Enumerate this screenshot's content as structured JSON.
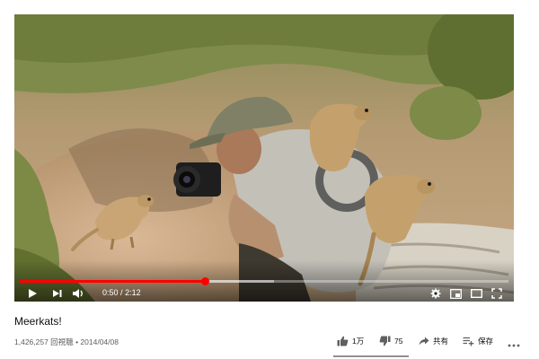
{
  "video": {
    "title": "Meerkats!",
    "views": "1,426,257 回視聴",
    "separator": "•",
    "date": "2014/04/08",
    "scene": "photographer-with-meerkats"
  },
  "player": {
    "current_time": "0:50",
    "time_separator": "/",
    "duration": "2:12",
    "progress_fraction": 0.379,
    "buffered_fraction": 0.52,
    "accent_color": "#ff0000",
    "controls": [
      "play-icon",
      "next-icon",
      "volume-icon",
      "settings-gear-icon",
      "miniplayer-icon",
      "theater-icon",
      "fullscreen-icon"
    ]
  },
  "actions": {
    "like_count": "1万",
    "dislike_count": "75",
    "share_label": "共有",
    "save_label": "保存"
  },
  "colors": {
    "title": "#0f0f0f",
    "meta": "#606060",
    "underline": "#909090"
  }
}
